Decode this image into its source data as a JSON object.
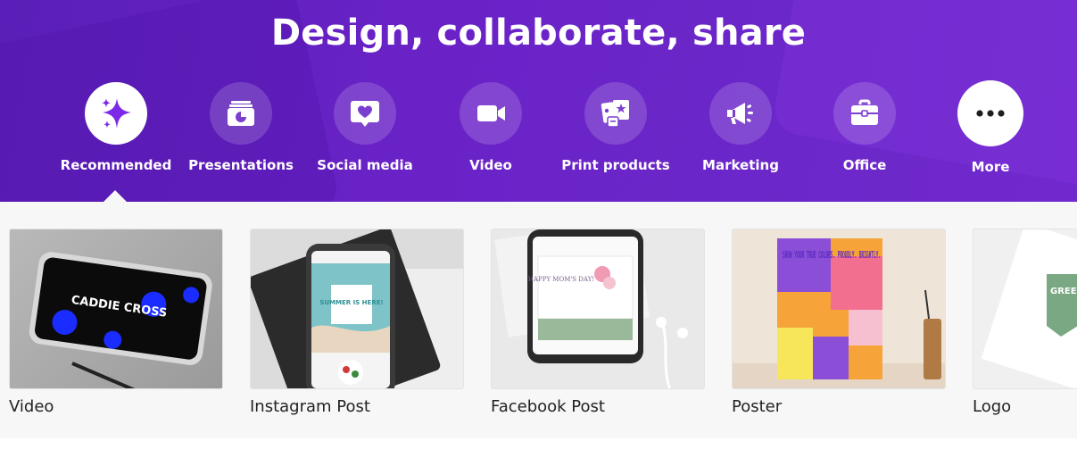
{
  "hero": {
    "title": "Design, collaborate, share"
  },
  "categories": [
    {
      "label": "Recommended",
      "icon": "sparkle-icon",
      "active": true
    },
    {
      "label": "Presentations",
      "icon": "presentation-icon"
    },
    {
      "label": "Social media",
      "icon": "heart-chat-icon"
    },
    {
      "label": "Video",
      "icon": "video-camera-icon"
    },
    {
      "label": "Print products",
      "icon": "print-products-icon"
    },
    {
      "label": "Marketing",
      "icon": "megaphone-icon"
    },
    {
      "label": "Office",
      "icon": "briefcase-icon"
    },
    {
      "label": "More",
      "icon": "more-dots-icon"
    }
  ],
  "templates": [
    {
      "label": "Video",
      "thumb_text": "CADDIE CROSS"
    },
    {
      "label": "Instagram Post",
      "thumb_text": "SUMMER IS HERE!"
    },
    {
      "label": "Facebook Post",
      "thumb_text": "HAPPY MOM'S DAY!"
    },
    {
      "label": "Poster",
      "thumb_text": "SHOW YOUR TRUE COLORS. PROUDLY. BRIGHTLY."
    },
    {
      "label": "Logo",
      "thumb_text": "GREEN FRESH"
    }
  ],
  "colors": {
    "hero_purple": "#6a22c7",
    "accent_violet": "#7d2ae8",
    "panel_bg": "#f7f7f7"
  }
}
